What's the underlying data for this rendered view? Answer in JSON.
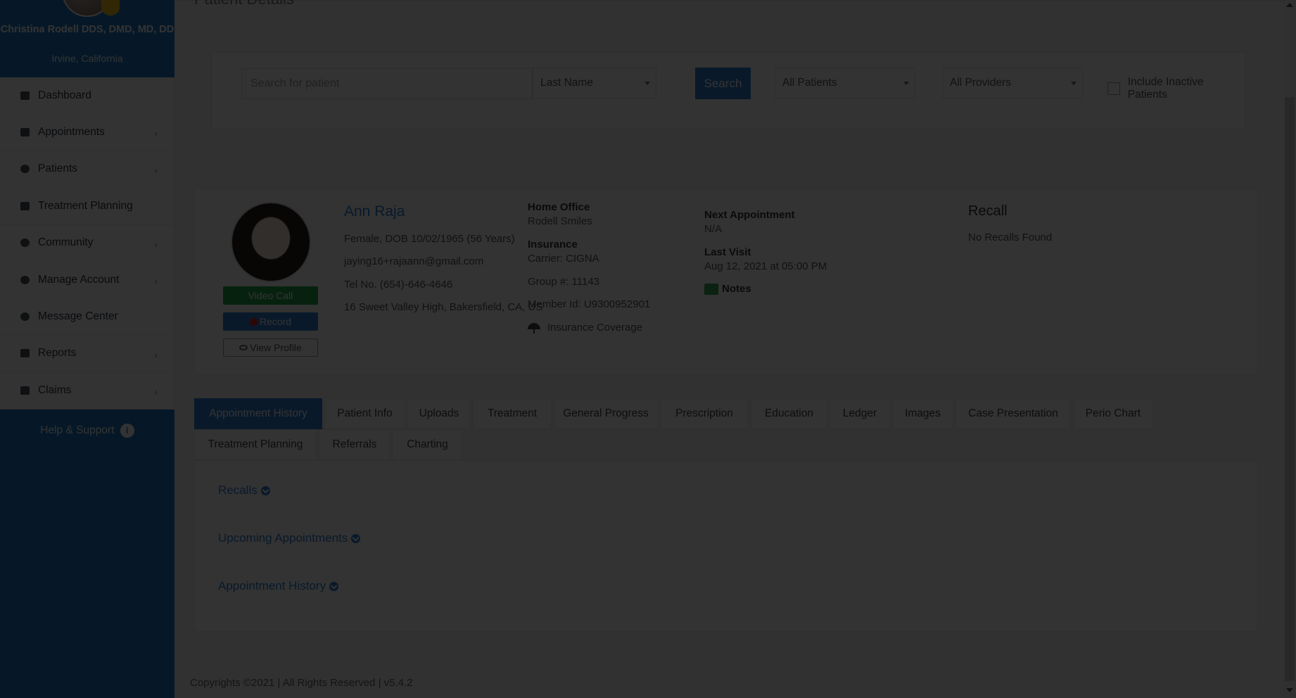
{
  "sidebar": {
    "user_name": "Christina Rodell DDS, DMD, MD, DD",
    "user_location": "Irvine, California",
    "items": [
      {
        "label": "Dashboard",
        "icon": "dashboard-icon",
        "has_submenu": false
      },
      {
        "label": "Appointments",
        "icon": "calendar-icon",
        "has_submenu": true
      },
      {
        "label": "Patients",
        "icon": "users-icon",
        "has_submenu": true
      },
      {
        "label": "Treatment Planning",
        "icon": "clipboard-icon",
        "has_submenu": false
      },
      {
        "label": "Community",
        "icon": "community-icon",
        "has_submenu": true
      },
      {
        "label": "Manage Account",
        "icon": "gear-icon",
        "has_submenu": true
      },
      {
        "label": "Message Center",
        "icon": "chat-icon",
        "has_submenu": false
      },
      {
        "label": "Reports",
        "icon": "file-icon",
        "has_submenu": true
      },
      {
        "label": "Claims",
        "icon": "plus-square-icon",
        "has_submenu": true
      }
    ],
    "help_label": "Help & Support",
    "chevron": "‹"
  },
  "page": {
    "title": "Patient Details"
  },
  "search": {
    "placeholder": "Search for patient",
    "field_select": "Last Name",
    "button": "Search",
    "patients_select": "All Patients",
    "providers_select": "All Providers",
    "inactive_label": "Include Inactive Patients"
  },
  "patient": {
    "name": "Ann Raja",
    "demographics": "Female, DOB 10/02/1965 (56 Years)",
    "email": "jaying16+rajaann@gmail.com",
    "phone": "Tel No. (654)-646-4646",
    "address": "16 Sweet Valley High, Bakersfield, CA, US",
    "video_call": "Video Call",
    "record": "Record",
    "view_profile": "View Profile",
    "home_office_label": "Home Office",
    "home_office": "Rodell Smiles",
    "insurance_label": "Insurance",
    "carrier": "Carrier: CIGNA",
    "group": "Group #: 11143",
    "member_id": "Member Id: U9300952901",
    "insurance_coverage": "Insurance Coverage",
    "next_appt_label": "Next Appointment",
    "next_appt": "N/A",
    "last_visit_label": "Last Visit",
    "last_visit": "Aug 12, 2021 at 05:00 PM",
    "notes": "Notes",
    "recall_title": "Recall",
    "recall_none": "No Recalls Found"
  },
  "tabs": [
    {
      "label": "Appointment History",
      "active": true
    },
    {
      "label": "Patient Info",
      "active": false
    },
    {
      "label": "Uploads",
      "active": false
    },
    {
      "label": "Treatment",
      "active": false
    },
    {
      "label": "General Progress",
      "active": false
    },
    {
      "label": "Prescription",
      "active": false
    },
    {
      "label": "Education",
      "active": false
    },
    {
      "label": "Ledger",
      "active": false
    },
    {
      "label": "Images",
      "active": false
    },
    {
      "label": "Case Presentation",
      "active": false
    },
    {
      "label": "Perio Chart",
      "active": false
    },
    {
      "label": "Treatment Planning",
      "active": false
    },
    {
      "label": "Referrals",
      "active": false
    },
    {
      "label": "Charting",
      "active": false
    }
  ],
  "sections": [
    {
      "label": "Recalls"
    },
    {
      "label": "Upcoming Appointments"
    },
    {
      "label": "Appointment History"
    }
  ],
  "footer": "Copyrights ©2021 | All Rights Reserved | v5.4.2",
  "colors": {
    "brand_blue": "#1f78c4",
    "accent_blue": "#2f7fd0",
    "video_green": "#25a64a",
    "overlay": "rgba(0,0,0,0.80)"
  }
}
